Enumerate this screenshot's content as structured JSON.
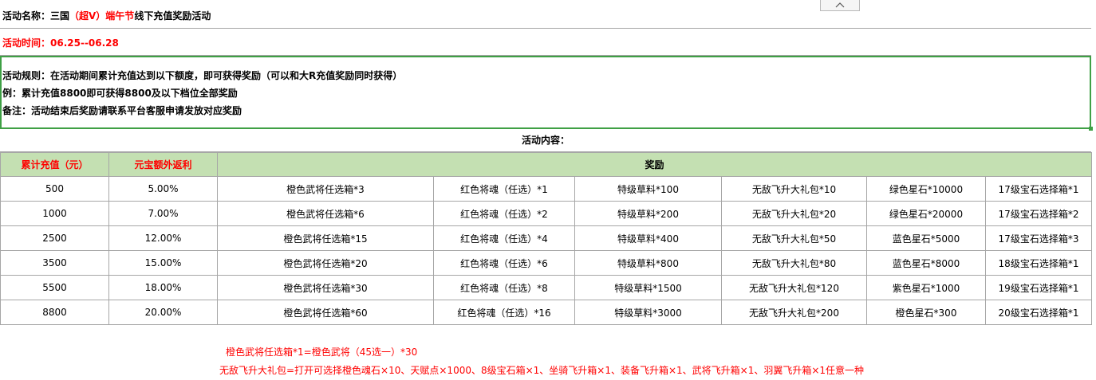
{
  "header": {
    "activity_label": "活动名称：三国",
    "activity_highlight": "（超V）端午节",
    "activity_suffix": "线下充值奖励活动",
    "time_label": "活动时间：06.25--06.28"
  },
  "rules": {
    "line1": "活动规则：在活动期间累计充值达到以下额度，即可获得奖励（可以和大R充值奖励同时获得）",
    "line2": "例：累计充值8800即可获得8800及以下档位全部奖励",
    "line3": "备注：活动结束后奖励请联系平台客服申请发放对应奖励"
  },
  "content_title": "活动内容：",
  "table": {
    "headers": [
      "累计充值（元）",
      "元宝额外返利",
      "奖励"
    ],
    "rows": [
      [
        "500",
        "5.00%",
        "橙色武将任选箱*3",
        "红色将魂（任选）*1",
        "特级草料*100",
        "无敌飞升大礼包*10",
        "绿色星石*10000",
        "17级宝石选择箱*1"
      ],
      [
        "1000",
        "7.00%",
        "橙色武将任选箱*6",
        "红色将魂（任选）*2",
        "特级草料*200",
        "无敌飞升大礼包*20",
        "绿色星石*20000",
        "17级宝石选择箱*2"
      ],
      [
        "2500",
        "12.00%",
        "橙色武将任选箱*15",
        "红色将魂（任选）*4",
        "特级草料*400",
        "无敌飞升大礼包*50",
        "蓝色星石*5000",
        "17级宝石选择箱*3"
      ],
      [
        "3500",
        "15.00%",
        "橙色武将任选箱*20",
        "红色将魂（任选）*6",
        "特级草料*800",
        "无敌飞升大礼包*80",
        "蓝色星石*8000",
        "18级宝石选择箱*1"
      ],
      [
        "5500",
        "18.00%",
        "橙色武将任选箱*30",
        "红色将魂（任选）*8",
        "特级草料*1500",
        "无敌飞升大礼包*120",
        "紫色星石*1000",
        "19级宝石选择箱*1"
      ],
      [
        "8800",
        "20.00%",
        "橙色武将任选箱*60",
        "红色将魂（任选）*16",
        "特级草料*3000",
        "无敌飞升大礼包*200",
        "橙色星石*300",
        "20级宝石选择箱*1"
      ]
    ]
  },
  "notes": {
    "note1": "橙色武将任选箱*1=橙色武将（45选一）*30",
    "note2": "无敌飞升大礼包=打开可选择橙色魂石×10、天赋点×1000、8级宝石箱×1、坐骑飞升箱×1、装备飞升箱×1、武将飞升箱×1、羽翼飞升箱×1任意一种"
  },
  "icons": {
    "collapse": "chevron-up-icon"
  },
  "colors": {
    "accent_red": "#ff0000",
    "header_green": "#c4e0b2",
    "selection_border": "#3fa045"
  }
}
